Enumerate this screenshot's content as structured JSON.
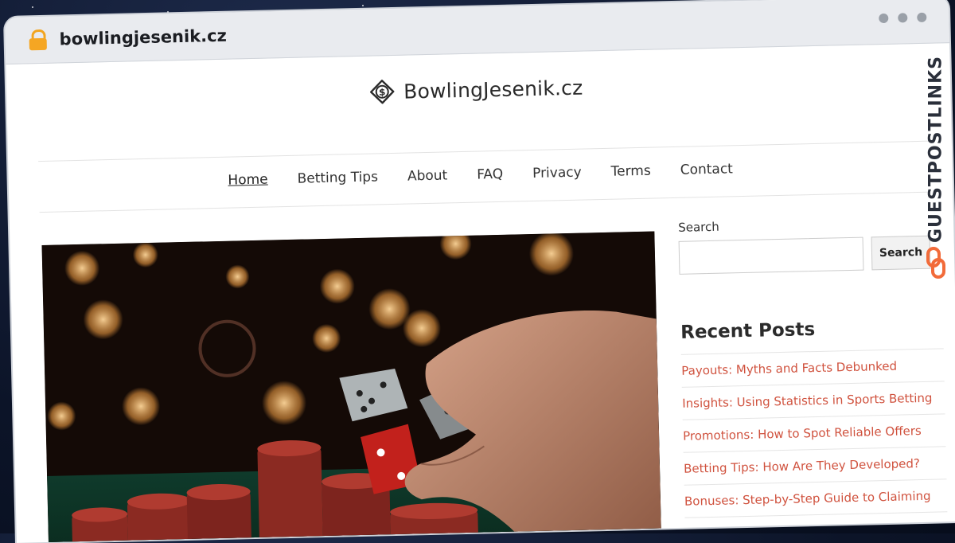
{
  "browser": {
    "url": "bowlingjesenik.cz"
  },
  "site": {
    "logo_text": "BowlingJesenik.cz",
    "nav": [
      {
        "label": "Home",
        "active": true
      },
      {
        "label": "Betting Tips"
      },
      {
        "label": "About"
      },
      {
        "label": "FAQ"
      },
      {
        "label": "Privacy"
      },
      {
        "label": "Terms"
      },
      {
        "label": "Contact"
      }
    ],
    "hero": {
      "alt": "Hand rolling dice over casino chips"
    }
  },
  "sidebar": {
    "search_label": "Search",
    "search_placeholder": "",
    "search_button": "Search",
    "recent_title": "Recent Posts",
    "recent_posts": [
      "Payouts: Myths and Facts Debunked",
      "Insights: Using Statistics in Sports Betting",
      "Promotions: How to Spot Reliable Offers",
      "Betting Tips: How Are They Developed?",
      "Bonuses: Step-by-Step Guide to Claiming"
    ]
  },
  "watermark": {
    "text": "GUESTPOSTLINKS"
  },
  "colors": {
    "link": "#d0523e",
    "lock": "#f5a623",
    "watermark_accent": "#f26b3a"
  },
  "icons": {
    "lock": "lock-icon",
    "logo": "dollar-diamond-icon"
  }
}
